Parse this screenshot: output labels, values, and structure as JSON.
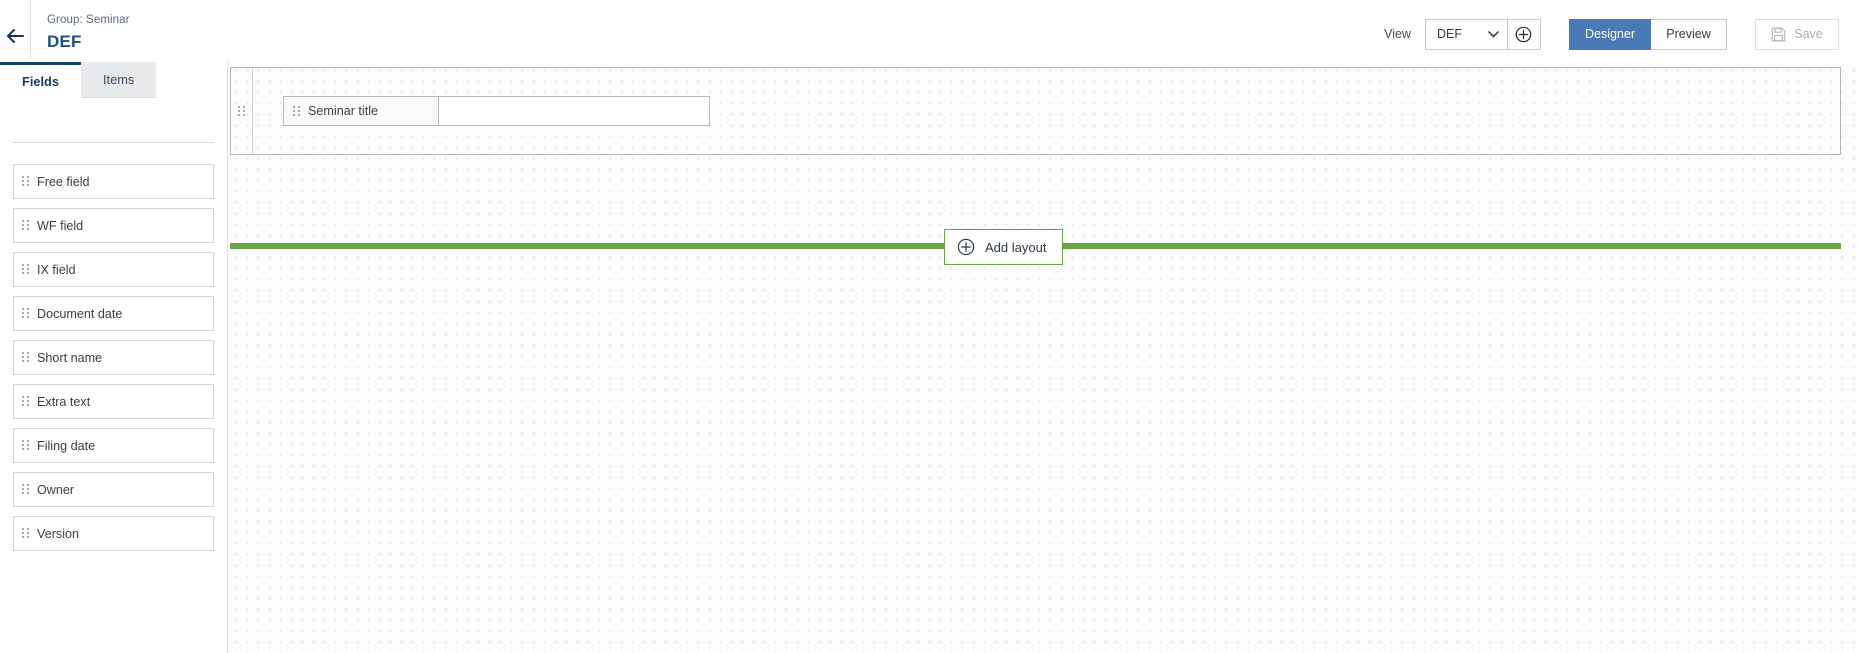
{
  "header": {
    "back_icon": "back-arrow-icon",
    "group_label": "Group: Seminar",
    "title": "DEF",
    "view_label": "View",
    "view_selected": "DEF",
    "view_options": [
      "DEF"
    ],
    "view_add_icon": "plus-circle-icon",
    "mode_designer": "Designer",
    "mode_preview": "Preview",
    "active_mode": "Designer",
    "save_label": "Save",
    "save_icon": "floppy-disk-icon",
    "save_enabled": false
  },
  "sidebar": {
    "tabs": [
      {
        "label": "Fields",
        "active": true
      },
      {
        "label": "Items",
        "active": false
      }
    ],
    "fields": [
      {
        "label": "Free field"
      },
      {
        "label": "WF field"
      },
      {
        "label": "IX field"
      },
      {
        "label": "Document date"
      },
      {
        "label": "Short name"
      },
      {
        "label": "Extra text"
      },
      {
        "label": "Filing date"
      },
      {
        "label": "Owner"
      },
      {
        "label": "Version"
      }
    ]
  },
  "canvas": {
    "layout_block": {
      "handle_icon": "drag-handle-icon",
      "field_pair": {
        "label": "Seminar title",
        "value": "",
        "placeholder": ""
      }
    },
    "add_layout": {
      "label": "Add layout",
      "icon": "plus-circle-icon"
    }
  },
  "colors": {
    "accent_blue": "#4a7ab5",
    "title_blue": "#1b4f8a",
    "tab_active_border": "#15436e",
    "add_layout_green": "#67a447"
  }
}
